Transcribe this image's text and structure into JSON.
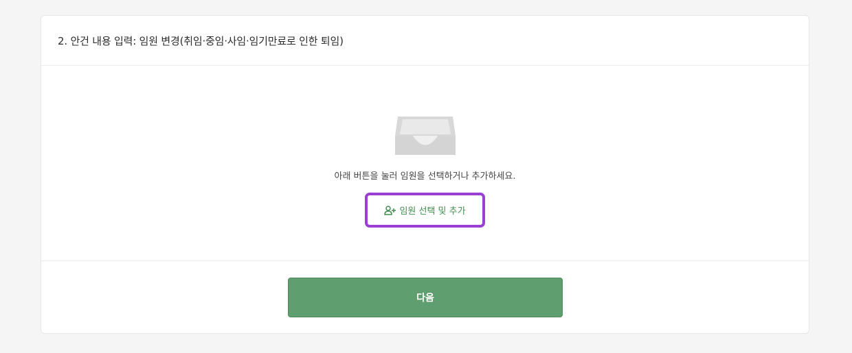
{
  "section": {
    "title": "2. 안건 내용 입력: 임원 변경(취임·중임·사임·임기만료로 인한 퇴임)"
  },
  "empty_state": {
    "icon": "inbox-tray-icon",
    "message": "아래 버튼을 눌러 임원을 선택하거나 추가하세요."
  },
  "add_officer_button": {
    "icon": "user-plus-icon",
    "label": "임원 선택 및 추가"
  },
  "footer": {
    "next_label": "다음"
  },
  "colors": {
    "accent_green": "#5f9f6f",
    "highlight_purple": "#9b3fd4"
  }
}
